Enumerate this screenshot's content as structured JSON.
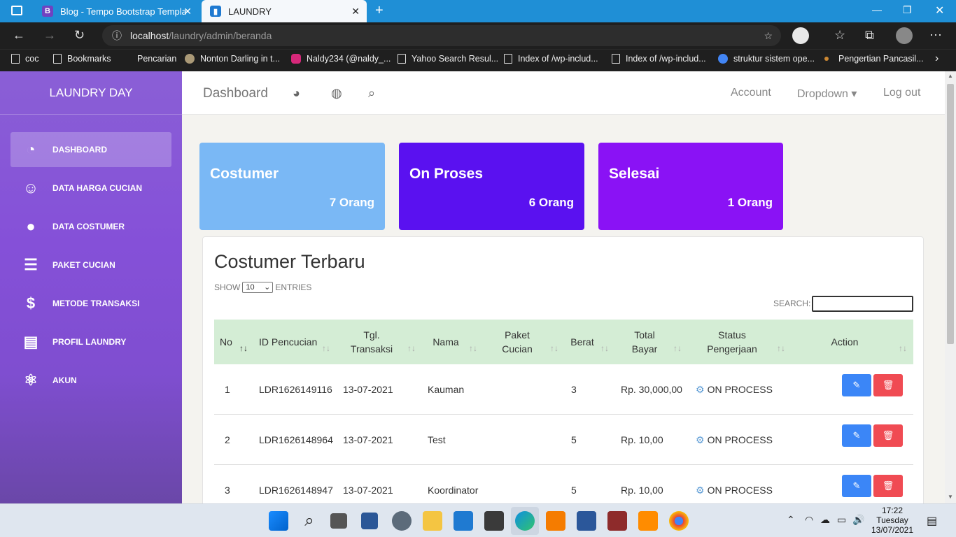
{
  "browser": {
    "tabs": [
      {
        "label": "Blog - Tempo Bootstrap Templat",
        "fav": "B"
      },
      {
        "label": "LAUNDRY",
        "fav": "▮"
      }
    ],
    "url_host": "localhost",
    "url_path": "/laundry/admin/beranda",
    "bookmarks": [
      "coc",
      "Bookmarks",
      "Pencarian",
      "Nonton Darling in t...",
      "Naldy234 (@naldy_...",
      "Yahoo Search Resul...",
      "Index of /wp-includ...",
      "Index of /wp-includ...",
      "struktur sistem ope...",
      "Pengertian Pancasil..."
    ]
  },
  "sidebar": {
    "brand": "LAUNDRY DAY",
    "items": [
      {
        "label": "DASHBOARD",
        "icon": "dashboard-icon",
        "glyph": "◔"
      },
      {
        "label": "DATA HARGA CUCIAN",
        "icon": "user-circle-icon",
        "glyph": "☺"
      },
      {
        "label": "DATA COSTUMER",
        "icon": "user-icon",
        "glyph": "●"
      },
      {
        "label": "PAKET CUCIAN",
        "icon": "clipboard-icon",
        "glyph": "☰"
      },
      {
        "label": "METODE TRANSAKSI",
        "icon": "money-icon",
        "glyph": "$"
      },
      {
        "label": "PROFIL LAUNDRY",
        "icon": "news-icon",
        "glyph": "▤"
      },
      {
        "label": "AKUN",
        "icon": "atom-icon",
        "glyph": "⚛"
      }
    ]
  },
  "topnav": {
    "title": "Dashboard",
    "account": "Account",
    "dropdown": "Dropdown ▾",
    "logout": "Log out"
  },
  "cards": [
    {
      "title": "Costumer",
      "value": "7 Orang",
      "color": "#7ab8f5"
    },
    {
      "title": "On Proses",
      "value": "6 Orang",
      "color": "#5a11f0"
    },
    {
      "title": "Selesai",
      "value": "1 Orang",
      "color": "#8a12f5"
    }
  ],
  "table": {
    "title": "Costumer Terbaru",
    "show": "SHOW",
    "entries": "ENTRIES",
    "entries_value": "10",
    "search_label": "SEARCH:",
    "headers": [
      "No",
      "ID Pencucian",
      "Tgl. Transaksi",
      "Nama",
      "Paket Cucian",
      "Berat",
      "Total Bayar",
      "Status Pengerjaan",
      "Action"
    ],
    "rows": [
      {
        "no": "1",
        "id": "LDR1626149116",
        "tgl": "13-07-2021",
        "nama": "Kauman",
        "paket": "",
        "berat": "3",
        "total": "Rp. 30,000,00",
        "status": "ON PROCESS"
      },
      {
        "no": "2",
        "id": "LDR1626148964",
        "tgl": "13-07-2021",
        "nama": "Test",
        "paket": "",
        "berat": "5",
        "total": "Rp. 10,00",
        "status": "ON PROCESS"
      },
      {
        "no": "3",
        "id": "LDR1626148947",
        "tgl": "13-07-2021",
        "nama": "Koordinator",
        "paket": "",
        "berat": "5",
        "total": "Rp. 10,00",
        "status": "ON PROCESS"
      }
    ]
  },
  "taskbar": {
    "time": "17:22",
    "day": "Tuesday",
    "date": "13/07/2021"
  }
}
